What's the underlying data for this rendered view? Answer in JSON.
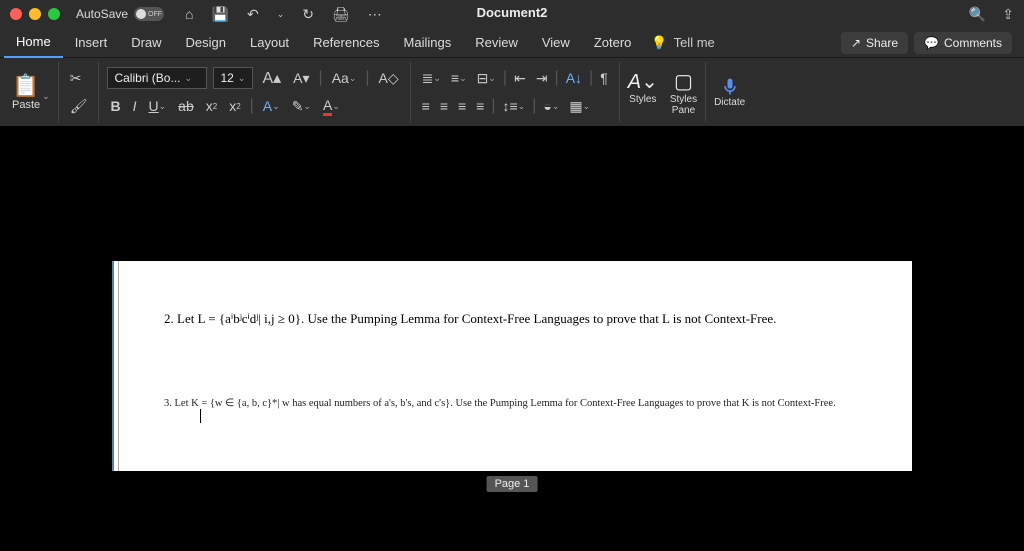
{
  "titlebar": {
    "autosave_label": "AutoSave",
    "autosave_state": "OFF",
    "doc_title": "Document2"
  },
  "tabs": {
    "items": [
      "Home",
      "Insert",
      "Draw",
      "Design",
      "Layout",
      "References",
      "Mailings",
      "Review",
      "View",
      "Zotero"
    ],
    "tellme": "Tell me",
    "share": "Share",
    "comments": "Comments"
  },
  "ribbon": {
    "paste": "Paste",
    "font_name": "Calibri (Bo...",
    "font_size": "12",
    "styles": "Styles",
    "styles_pane": "Styles\nPane",
    "dictate": "Dictate"
  },
  "document": {
    "q2": "2. Let L = {aⁱbʲcⁱdʲ| i,j ≥ 0}. Use the Pumping Lemma for Context-Free Languages to prove that L is not Context-Free.",
    "q3": "3. Let K = {w ∈ {a, b, c}*| w has equal numbers of a's, b's, and c's}. Use the Pumping Lemma for Context-Free Languages to prove that K is not Context-Free."
  },
  "page_badge": "Page 1"
}
